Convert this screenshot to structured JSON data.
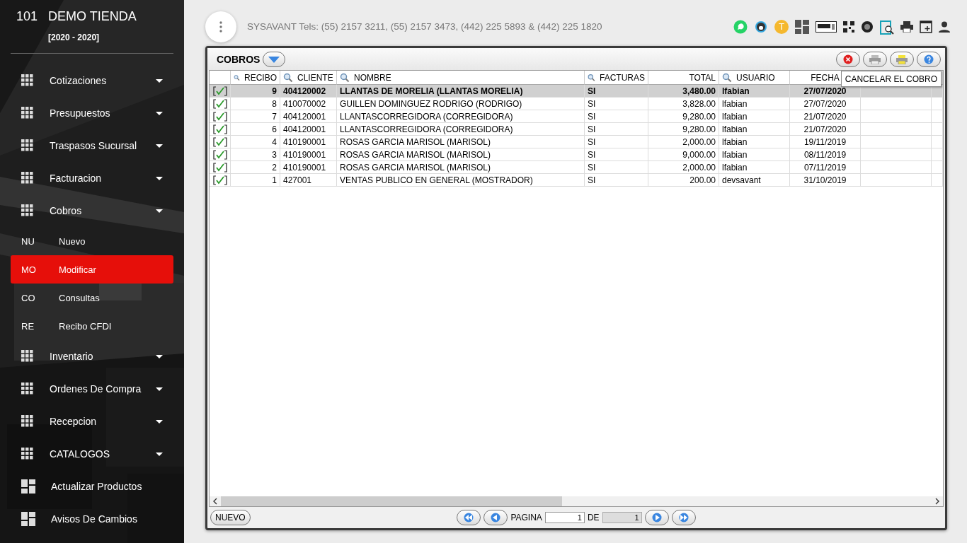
{
  "sidebar": {
    "store_number": "101",
    "store_name": "DEMO TIENDA",
    "period": "[2020 - 2020]",
    "items": [
      {
        "kind": "group",
        "label": "Cotizaciones"
      },
      {
        "kind": "group",
        "label": "Presupuestos"
      },
      {
        "kind": "group",
        "label": "Traspasos Sucursal"
      },
      {
        "kind": "group",
        "label": "Facturacion"
      },
      {
        "kind": "group",
        "label": "Cobros",
        "children": [
          {
            "abbr": "NU",
            "label": "Nuevo",
            "selected": false
          },
          {
            "abbr": "MO",
            "label": "Modificar",
            "selected": true
          },
          {
            "abbr": "CO",
            "label": "Consultas",
            "selected": false
          },
          {
            "abbr": "RE",
            "label": "Recibo CFDI",
            "selected": false
          }
        ]
      },
      {
        "kind": "group",
        "label": "Inventario"
      },
      {
        "kind": "group",
        "label": "Ordenes De Compra"
      },
      {
        "kind": "group",
        "label": "Recepcion"
      },
      {
        "kind": "group",
        "label": "CATALOGOS"
      },
      {
        "kind": "link",
        "label": "Actualizar Productos"
      },
      {
        "kind": "link",
        "label": "Avisos De Cambios"
      }
    ]
  },
  "topbar": {
    "contact": "SYSAVANT Tels: (55) 2157 3211, (55) 2157 3473, (442) 225 5893 & (442) 225 1820",
    "avatar_letter": "T"
  },
  "panel": {
    "title": "COBROS",
    "tooltip": "CANCELAR EL COBRO",
    "table": {
      "columns": [
        {
          "label": "RECIBO",
          "searchable": true
        },
        {
          "label": "CLIENTE",
          "searchable": true
        },
        {
          "label": "NOMBRE",
          "searchable": true
        },
        {
          "label": "FACTURAS",
          "searchable": true
        },
        {
          "label": "TOTAL",
          "searchable": false
        },
        {
          "label": "USUARIO",
          "searchable": true
        },
        {
          "label": "FECHA",
          "searchable": false
        }
      ],
      "rows": [
        {
          "checked": true,
          "selected": true,
          "cells": [
            "9",
            "404120002",
            "LLANTAS DE MORELIA (LLANTAS MORELIA)",
            "SI",
            "3,480.00",
            "lfabian",
            "27/07/2020"
          ]
        },
        {
          "checked": true,
          "selected": false,
          "cells": [
            "8",
            "410070002",
            "GUILLEN DOMINGUEZ RODRIGO (RODRIGO)",
            "SI",
            "3,828.00",
            "lfabian",
            "27/07/2020"
          ]
        },
        {
          "checked": true,
          "selected": false,
          "cells": [
            "7",
            "404120001",
            "LLANTASCORREGIDORA (CORREGIDORA)",
            "SI",
            "9,280.00",
            "lfabian",
            "21/07/2020"
          ]
        },
        {
          "checked": true,
          "selected": false,
          "cells": [
            "6",
            "404120001",
            "LLANTASCORREGIDORA (CORREGIDORA)",
            "SI",
            "9,280.00",
            "lfabian",
            "21/07/2020"
          ]
        },
        {
          "checked": true,
          "selected": false,
          "cells": [
            "4",
            "410190001",
            "ROSAS GARCIA MARISOL (MARISOL)",
            "SI",
            "2,000.00",
            "lfabian",
            "19/11/2019"
          ]
        },
        {
          "checked": true,
          "selected": false,
          "cells": [
            "3",
            "410190001",
            "ROSAS GARCIA MARISOL (MARISOL)",
            "SI",
            "9,000.00",
            "lfabian",
            "08/11/2019"
          ]
        },
        {
          "checked": true,
          "selected": false,
          "cells": [
            "2",
            "410190001",
            "ROSAS GARCIA MARISOL (MARISOL)",
            "SI",
            "2,000.00",
            "lfabian",
            "07/11/2019"
          ]
        },
        {
          "checked": true,
          "selected": false,
          "cells": [
            "1",
            "427001",
            "VENTAS PUBLICO EN GENERAL (MOSTRADOR)",
            "SI",
            "200.00",
            "devsavant",
            "31/10/2019"
          ]
        }
      ]
    },
    "footer": {
      "new_button": "NUEVO",
      "page_label": "PAGINA",
      "page": "1",
      "of_label": "DE",
      "total_pages": "1"
    }
  }
}
